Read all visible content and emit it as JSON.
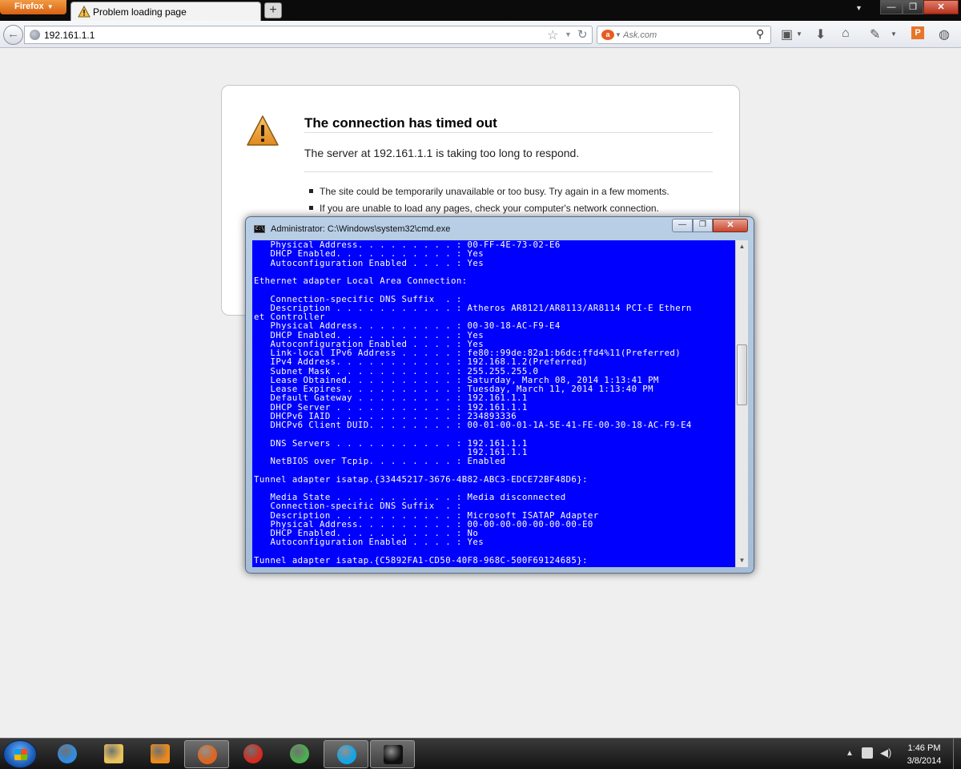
{
  "browser": {
    "app_button_label": "Firefox",
    "tab_title": "Problem loading page",
    "new_tab_label": "+",
    "url": "192.161.1.1",
    "search_placeholder": "Ask.com",
    "window_controls": {
      "minimize": "—",
      "maximize": "❐",
      "close": "✕"
    }
  },
  "error_page": {
    "title": "The connection has timed out",
    "description": "The server at 192.161.1.1 is taking too long to respond.",
    "suggestions": [
      "The site could be temporarily unavailable or too busy. Try again in a few moments.",
      "If you are unable to load any pages, check your computer's network connection."
    ]
  },
  "cmd": {
    "title": "Administrator: C:\\Windows\\system32\\cmd.exe",
    "icon_text": "C:\\",
    "lines": [
      "   Physical Address. . . . . . . . . : 00-FF-4E-73-02-E6",
      "   DHCP Enabled. . . . . . . . . . . : Yes",
      "   Autoconfiguration Enabled . . . . : Yes",
      "",
      "Ethernet adapter Local Area Connection:",
      "",
      "   Connection-specific DNS Suffix  . :",
      "   Description . . . . . . . . . . . : Atheros AR8121/AR8113/AR8114 PCI-E Ethern",
      "et Controller",
      "   Physical Address. . . . . . . . . : 00-30-18-AC-F9-E4",
      "   DHCP Enabled. . . . . . . . . . . : Yes",
      "   Autoconfiguration Enabled . . . . : Yes",
      "   Link-local IPv6 Address . . . . . : fe80::99de:82a1:b6dc:ffd4%11(Preferred)",
      "   IPv4 Address. . . . . . . . . . . : 192.168.1.2(Preferred)",
      "   Subnet Mask . . . . . . . . . . . : 255.255.255.0",
      "   Lease Obtained. . . . . . . . . . : Saturday, March 08, 2014 1:13:41 PM",
      "   Lease Expires . . . . . . . . . . : Tuesday, March 11, 2014 1:13:40 PM",
      "   Default Gateway . . . . . . . . . : 192.161.1.1",
      "   DHCP Server . . . . . . . . . . . : 192.161.1.1",
      "   DHCPv6 IAID . . . . . . . . . . . : 234893336",
      "   DHCPv6 Client DUID. . . . . . . . : 00-01-00-01-1A-5E-41-FE-00-30-18-AC-F9-E4",
      "",
      "   DNS Servers . . . . . . . . . . . : 192.161.1.1",
      "                                       192.161.1.1",
      "   NetBIOS over Tcpip. . . . . . . . : Enabled",
      "",
      "Tunnel adapter isatap.{33445217-3676-4B82-ABC3-EDCE72BF48D6}:",
      "",
      "   Media State . . . . . . . . . . . : Media disconnected",
      "   Connection-specific DNS Suffix  . :",
      "   Description . . . . . . . . . . . : Microsoft ISATAP Adapter",
      "   Physical Address. . . . . . . . . : 00-00-00-00-00-00-00-E0",
      "   DHCP Enabled. . . . . . . . . . . : No",
      "   Autoconfiguration Enabled . . . . : Yes",
      "",
      "Tunnel adapter isatap.{C5892FA1-CD50-40F8-968C-500F69124685}:"
    ]
  },
  "taskbar": {
    "time": "1:46 PM",
    "date": "3/8/2014",
    "apps": [
      {
        "name": "internet-explorer",
        "color": "#2f8de4",
        "active": false
      },
      {
        "name": "file-explorer",
        "color": "#e8c25a",
        "active": false
      },
      {
        "name": "media-player",
        "color": "#e98a1d",
        "active": false
      },
      {
        "name": "firefox",
        "color": "#e0641c",
        "active": true
      },
      {
        "name": "opera",
        "color": "#d52b1e",
        "active": false
      },
      {
        "name": "chrome",
        "color": "#4caf50",
        "active": false
      },
      {
        "name": "skype",
        "color": "#12a5e8",
        "active": true
      },
      {
        "name": "command-prompt",
        "color": "#111111",
        "active": true
      }
    ]
  }
}
